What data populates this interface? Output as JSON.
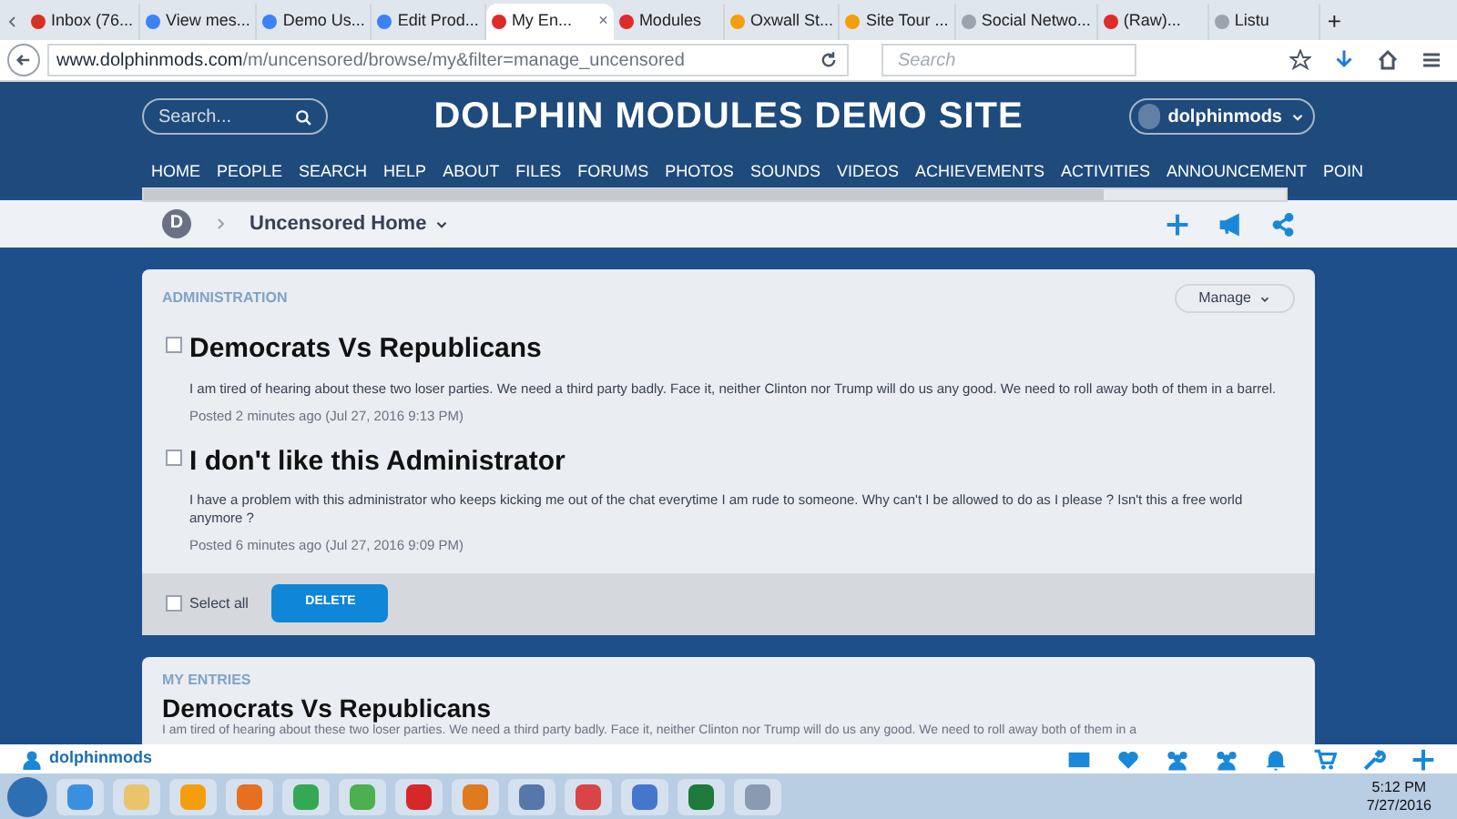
{
  "browser": {
    "tabs": [
      {
        "label": "Inbox (76...",
        "selected": false,
        "color": "#d93025"
      },
      {
        "label": "View mes...",
        "selected": false,
        "color": "#3b82f6"
      },
      {
        "label": "Demo Us...",
        "selected": false,
        "color": "#3b82f6"
      },
      {
        "label": "Edit Prod...",
        "selected": false,
        "color": "#3b82f6"
      },
      {
        "label": "My En...",
        "selected": true,
        "color": "#e02b2b"
      },
      {
        "label": "Modules",
        "selected": false,
        "color": "#e02b2b"
      },
      {
        "label": "Oxwall St...",
        "selected": false,
        "color": "#f59e0b"
      },
      {
        "label": "Site Tour ...",
        "selected": false,
        "color": "#f59e0b"
      },
      {
        "label": "Social Netwo...",
        "selected": false,
        "color": "#9ca3af"
      },
      {
        "label": "(Raw)...",
        "selected": false,
        "color": "#e02b2b"
      },
      {
        "label": "Listu",
        "selected": false,
        "color": "#9ca3af"
      }
    ],
    "tab_close": "×",
    "new_tab": "+",
    "url_domain": "www.dolphinmods.com",
    "url_path": "/m/uncensored/browse/my&filter=manage_uncensored",
    "search_placeholder": "Search"
  },
  "site": {
    "search_placeholder": "Search...",
    "title": "DOLPHIN MODULES DEMO SITE",
    "user": "dolphinmods",
    "menu": [
      "HOME",
      "PEOPLE",
      "SEARCH",
      "HELP",
      "ABOUT",
      "FILES",
      "FORUMS",
      "PHOTOS",
      "SOUNDS",
      "VIDEOS",
      "ACHIEVEMENTS",
      "ACTIVITIES",
      "ANNOUNCEMENT",
      "POIN"
    ],
    "avatar_letter": "D",
    "breadcrumb": "Uncensored Home"
  },
  "admin_card": {
    "heading": "ADMINISTRATION",
    "manage": "Manage",
    "entries": [
      {
        "title": "Democrats Vs Republicans",
        "checked": false,
        "text": "I am tired of hearing about these two loser parties. We need a third party badly. Face it, neither Clinton nor Trump will do us any good. We need to roll away both of them in a barrel.",
        "meta": "Posted 2 minutes ago (Jul 27, 2016 9:13 PM)"
      },
      {
        "title": "I don't like this Administrator",
        "checked": false,
        "text": "I have a problem with this administrator who keeps kicking me out of the chat everytime I am rude to someone. Why can't I be allowed to do as I please ? Isn't this a free world anymore ?",
        "meta": "Posted 6 minutes ago (Jul 27, 2016 9:09 PM)"
      }
    ],
    "select_all": "Select all",
    "select_all_checked": false,
    "delete": "DELETE"
  },
  "entries_card": {
    "heading": "MY ENTRIES",
    "title": "Democrats Vs Republicans",
    "text": "I am tired of hearing about these two loser parties. We need a third party badly. Face it, neither Clinton nor Trump will do us any good. We need to roll away both of them in a"
  },
  "bottom_bar": {
    "user": "dolphinmods"
  },
  "taskbar": {
    "time": "5:12 PM",
    "date": "7/27/2016"
  }
}
